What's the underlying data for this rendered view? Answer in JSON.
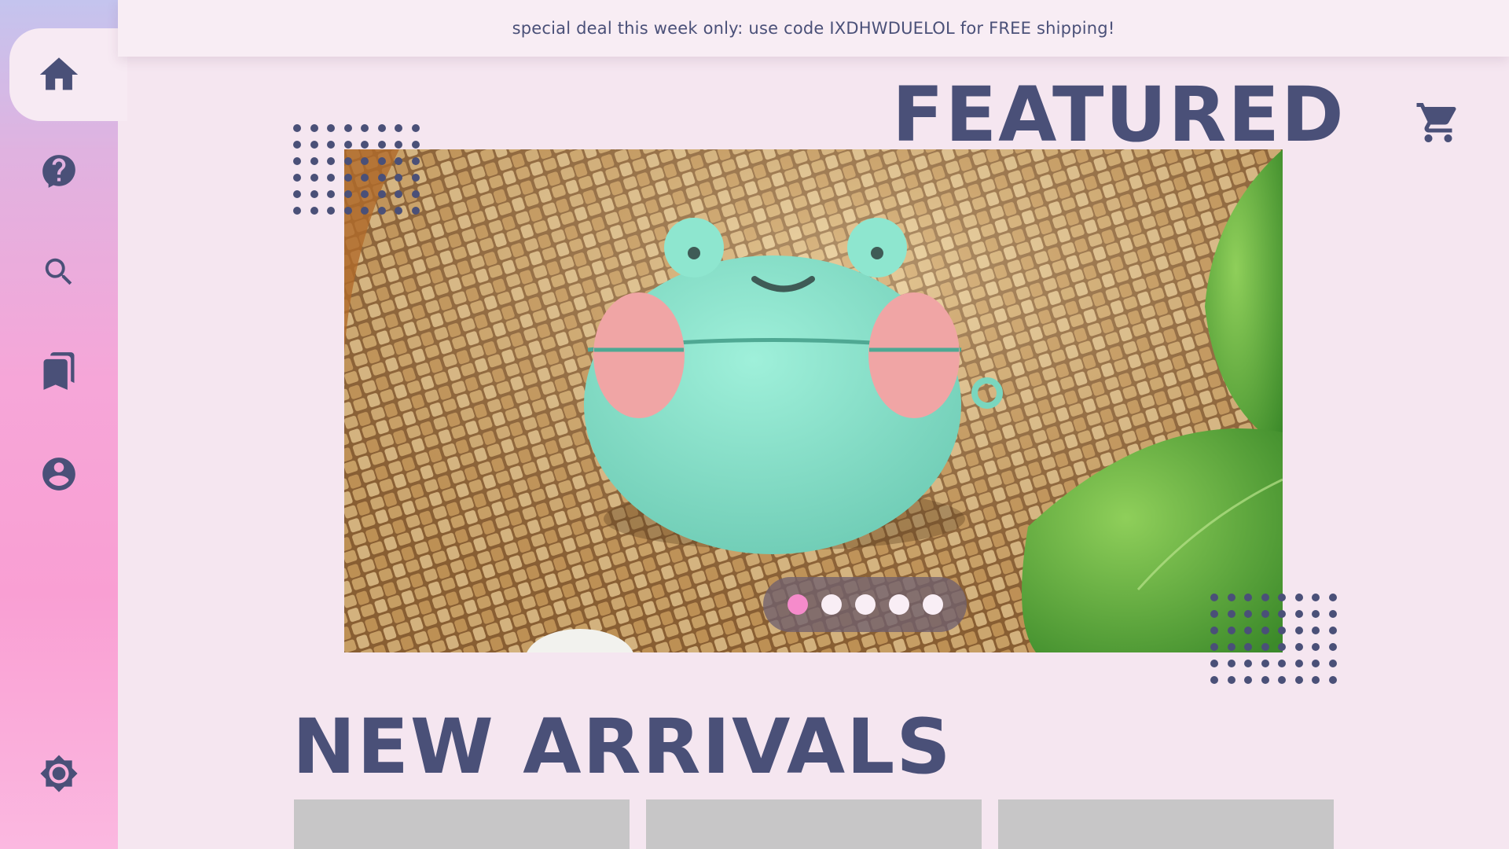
{
  "promo": {
    "text": "special deal this week only: use code IXDHWDUELOL for FREE shipping!"
  },
  "sidebar": {
    "items": [
      {
        "name": "home",
        "icon": "home-icon",
        "active": true
      },
      {
        "name": "help",
        "icon": "help-icon",
        "active": false
      },
      {
        "name": "search",
        "icon": "search-icon",
        "active": false
      },
      {
        "name": "bookmarks",
        "icon": "bookmarks-icon",
        "active": false
      },
      {
        "name": "account",
        "icon": "account-icon",
        "active": false
      }
    ],
    "theme_toggle": {
      "icon": "sun-icon"
    }
  },
  "header": {
    "cart_icon": "cart-icon"
  },
  "featured": {
    "title": "FEATURED",
    "carousel": {
      "slide_count": 5,
      "active_index": 0,
      "image_subject": "frog-earbud-case"
    }
  },
  "new_arrivals": {
    "title": "NEW ARRIVALS",
    "card_count": 3
  },
  "colors": {
    "text": "#4a5078",
    "background": "#f5e6f0",
    "accent_pink": "#f58bcb",
    "card_placeholder": "#c7c6c7"
  }
}
